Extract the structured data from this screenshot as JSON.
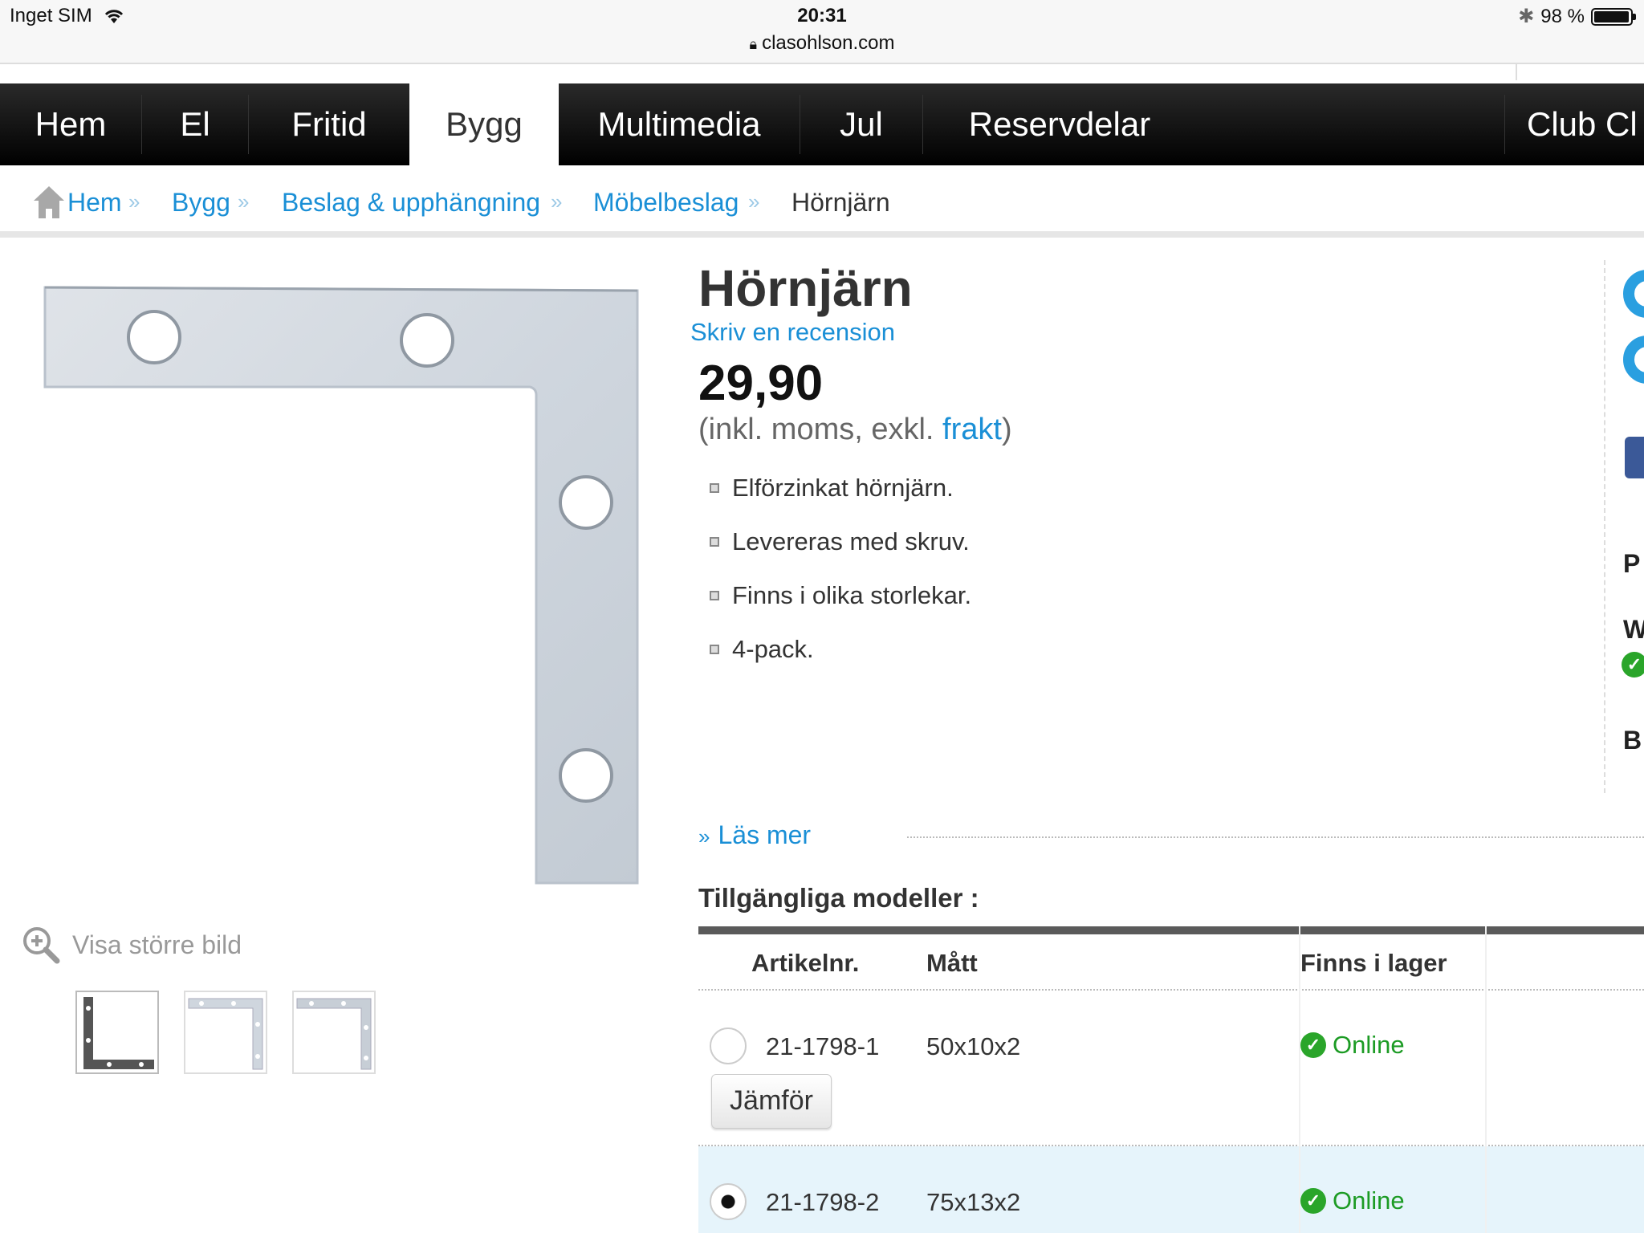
{
  "status": {
    "carrier": "Inget SIM",
    "time": "20:31",
    "url": "clasohlson.com",
    "battery": "98 %"
  },
  "nav": {
    "items": [
      "Hem",
      "El",
      "Fritid",
      "Bygg",
      "Multimedia",
      "Jul",
      "Reservdelar"
    ],
    "active": "Bygg",
    "club": "Club Cl"
  },
  "breadcrumb": {
    "items": [
      "Hem",
      "Bygg",
      "Beslag & upphängning",
      "Möbelbeslag"
    ],
    "current": "Hörnjärn"
  },
  "product": {
    "title": "Hörnjärn",
    "review": "Skriv en recension",
    "price": "29,90",
    "vat_prefix": "(inkl. moms,  exkl. ",
    "vat_link": "frakt",
    "vat_suffix": ")",
    "features": [
      "Elförzinkat hörnjärn.",
      "Levereras med skruv.",
      "Finns i olika storlekar.",
      "4-pack."
    ],
    "read_more": "Läs mer",
    "zoom_label": "Visa större bild"
  },
  "models": {
    "title": "Tillgängliga modeller :",
    "headers": {
      "art": "Artikelnr.",
      "size": "Mått",
      "stock": "Finns i lager"
    },
    "rows": [
      {
        "art": "21-1798-1",
        "size": "50x10x2",
        "stock": "Online",
        "selected": false
      },
      {
        "art": "21-1798-2",
        "size": "75x13x2",
        "stock": "Online",
        "selected": true
      }
    ],
    "compare": "Jämför"
  },
  "right_panel": {
    "letters": [
      "P",
      "W",
      "B"
    ]
  },
  "colors": {
    "accent": "#1a8fd6",
    "stock": "#1c9b24",
    "nav_bg": "#000000"
  }
}
